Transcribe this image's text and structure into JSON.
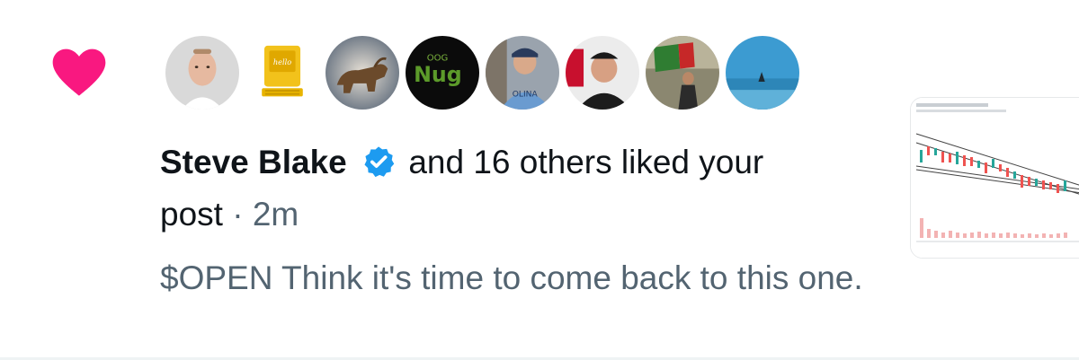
{
  "notification": {
    "type_icon": "heart-icon",
    "accent_color": "#f91880",
    "liker_name": "Steve Blake",
    "verified_icon": "verified-badge-icon",
    "verified_color": "#1d9bf0",
    "summary_text": "and 16 others liked your",
    "summary_text_cont": "post",
    "separator": "·",
    "timestamp": "2m",
    "post_text": "$OPEN Think it's time to come back to this one.",
    "avatars": [
      {
        "name": "avatar-steve-blake"
      },
      {
        "name": "avatar-retro-computer"
      },
      {
        "name": "avatar-wall-street-bull"
      },
      {
        "name": "avatar-nugs"
      },
      {
        "name": "avatar-carolina-fan"
      },
      {
        "name": "avatar-man-with-cap"
      },
      {
        "name": "avatar-flag-bearer"
      },
      {
        "name": "avatar-ocean-scene"
      }
    ],
    "thumbnail": "candlestick-chart-thumbnail"
  }
}
